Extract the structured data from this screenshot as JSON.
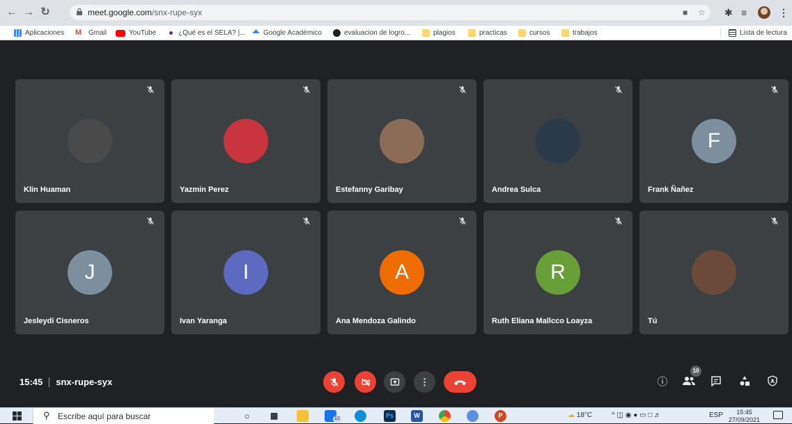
{
  "browser": {
    "url_host": "meet.google.com",
    "url_path": "/snx-rupe-syx"
  },
  "bookmarks": [
    {
      "label": "Aplicaciones"
    },
    {
      "label": "Gmail"
    },
    {
      "label": "YouTube"
    },
    {
      "label": "¿Qué es el SELA? |..."
    },
    {
      "label": "Google Académico"
    },
    {
      "label": "evaluacion de logro..."
    },
    {
      "label": "plagios"
    },
    {
      "label": "practicas"
    },
    {
      "label": "cursos"
    },
    {
      "label": "trabajos"
    }
  ],
  "reading_list": "Lista de lectura",
  "participants": [
    {
      "name": "Klin Huaman",
      "initial": "",
      "avatar_color": "#4a4a4a"
    },
    {
      "name": "Yazmin Perez",
      "initial": "",
      "avatar_color": "#c8353f"
    },
    {
      "name": "Estefanny Garibay",
      "initial": "",
      "avatar_color": "#8c6b57"
    },
    {
      "name": "Andrea Sulca",
      "initial": "",
      "avatar_color": "#2a3a48"
    },
    {
      "name": "Frank Ñañez",
      "initial": "F",
      "avatar_color": "#7b8f9e"
    },
    {
      "name": "Jesleydi Cisneros",
      "initial": "J",
      "avatar_color": "#7b8f9e"
    },
    {
      "name": "Ivan Yaranga",
      "initial": "I",
      "avatar_color": "#5c6bc0"
    },
    {
      "name": "Ana Mendoza Galindo",
      "initial": "A",
      "avatar_color": "#ef6c00"
    },
    {
      "name": "Ruth Eliana Mallcco Loayza",
      "initial": "R",
      "avatar_color": "#689f38"
    },
    {
      "name": "Tú",
      "initial": "",
      "avatar_color": "#6b4a3a"
    }
  ],
  "meeting": {
    "time": "15:45",
    "separator": "|",
    "code": "snx-rupe-syx",
    "participant_count": "10"
  },
  "taskbar": {
    "search_placeholder": "Escribe aquí para buscar",
    "weather": "18°C",
    "language": "ESP",
    "time": "15:45",
    "date": "27/09/2021",
    "mail_badge": "12"
  }
}
